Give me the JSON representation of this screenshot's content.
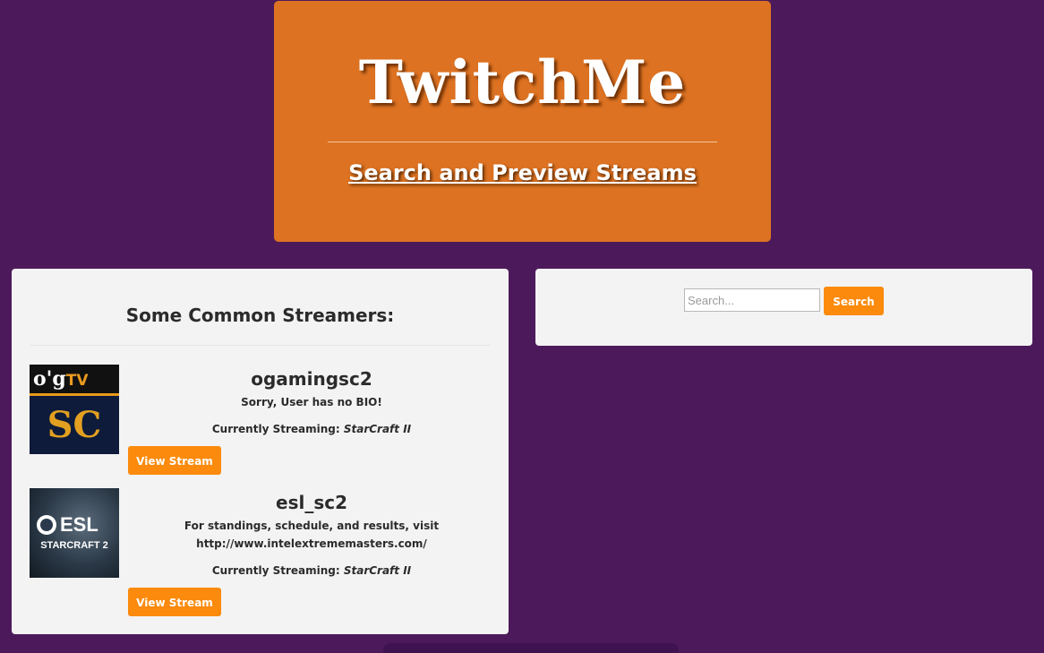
{
  "header": {
    "title": "TwitchMe",
    "subtitle": "Search and Preview Streams"
  },
  "streamers_panel": {
    "heading": "Some Common Streamers:",
    "streamers": [
      {
        "name": "ogamingsc2",
        "bio": "Sorry, User has no BIO!",
        "game_prefix": "Currently Streaming: ",
        "game": "StarCraft II",
        "button_label": "View Stream",
        "thumb_text": [
          "o'g",
          "TV",
          "SC"
        ]
      },
      {
        "name": "esl_sc2",
        "bio": "For standings, schedule, and results, visit http://www.intelextrememasters.com/",
        "game_prefix": "Currently Streaming: ",
        "game": "StarCraft II",
        "button_label": "View Stream",
        "thumb_text": [
          "ESL",
          "STARCRAFT 2"
        ]
      }
    ]
  },
  "search": {
    "placeholder": "Search...",
    "value": "",
    "button_label": "Search"
  },
  "colors": {
    "background": "#4c1a5a",
    "header": "#dc7222",
    "panel": "#f3f3f3",
    "button": "#fb8a0d"
  }
}
